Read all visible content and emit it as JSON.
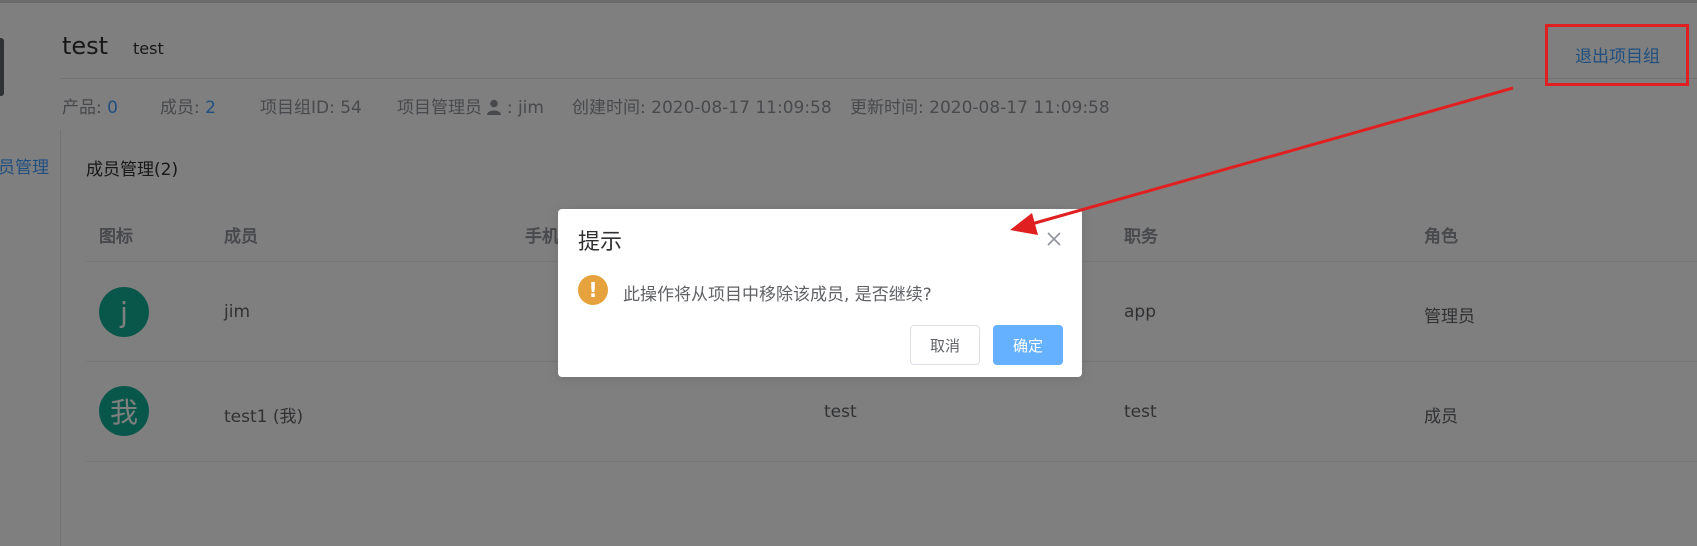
{
  "header": {
    "title": "test",
    "subtitle": "test",
    "leave_button": "退出项目组"
  },
  "meta": {
    "products_label": "产品:",
    "products_value": "0",
    "members_label": "成员:",
    "members_value": "2",
    "group_id": "项目组ID: 54",
    "admin_label": "项目管理员",
    "admin_value": ": jim",
    "created": "创建时间: 2020-08-17 11:09:58",
    "updated": "更新时间: 2020-08-17 11:09:58"
  },
  "nav": {
    "member_mgmt_partial": "员管理"
  },
  "section": {
    "title": "成员管理(2)"
  },
  "table": {
    "headers": [
      "图标",
      "成员",
      "手机",
      "职务",
      "角色"
    ],
    "rows": [
      {
        "avatar": "j",
        "member": "jim",
        "col3": "",
        "title": "app",
        "role": "管理员"
      },
      {
        "avatar": "我",
        "member": "test1 (我)",
        "col3": "test",
        "title": "test",
        "role": "成员"
      }
    ]
  },
  "dialog": {
    "title": "提示",
    "message": "此操作将从项目中移除该成员, 是否继续?",
    "cancel": "取消",
    "confirm": "确定",
    "warn_icon": "!",
    "close_icon": "close-icon"
  },
  "annotation": {
    "color": "#e02020"
  },
  "colors": {
    "accent": "#409eff",
    "avatar": "#13ae96",
    "warning": "#e6a23c"
  }
}
